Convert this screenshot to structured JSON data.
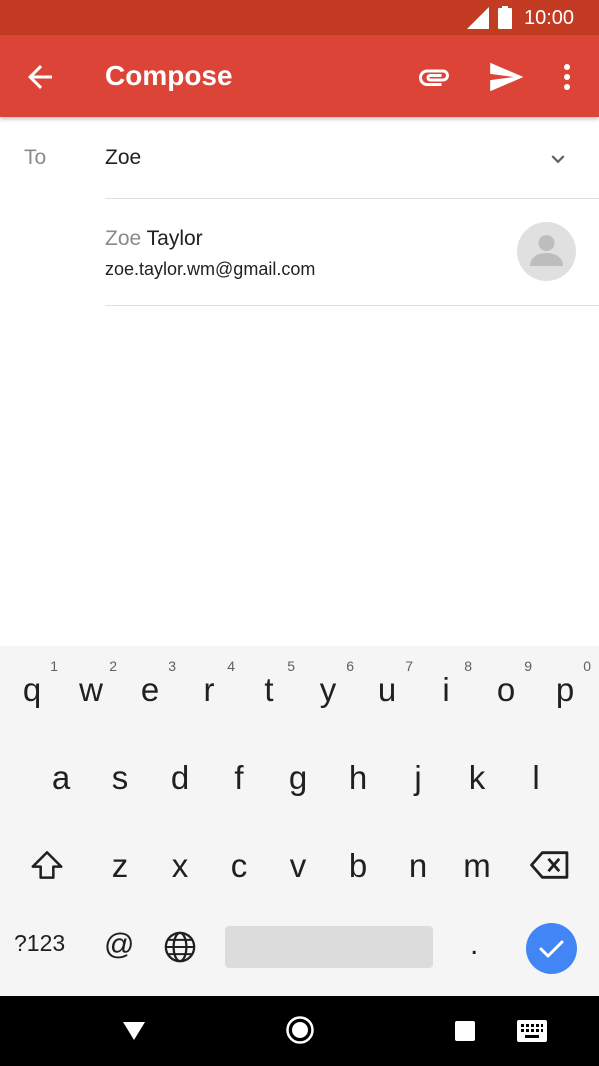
{
  "status_bar": {
    "time": "10:00"
  },
  "app_bar": {
    "title": "Compose"
  },
  "to_field": {
    "label": "To",
    "value": "Zoe"
  },
  "suggestion": {
    "name_match": "Zoe",
    "name_rest": " Taylor",
    "email": "zoe.taylor.wm@gmail.com"
  },
  "keyboard": {
    "row1": [
      {
        "char": "q",
        "hint": "1"
      },
      {
        "char": "w",
        "hint": "2"
      },
      {
        "char": "e",
        "hint": "3"
      },
      {
        "char": "r",
        "hint": "4"
      },
      {
        "char": "t",
        "hint": "5"
      },
      {
        "char": "y",
        "hint": "6"
      },
      {
        "char": "u",
        "hint": "7"
      },
      {
        "char": "i",
        "hint": "8"
      },
      {
        "char": "o",
        "hint": "9"
      },
      {
        "char": "p",
        "hint": "0"
      }
    ],
    "row2": [
      "a",
      "s",
      "d",
      "f",
      "g",
      "h",
      "j",
      "k",
      "l"
    ],
    "row3": [
      "z",
      "x",
      "c",
      "v",
      "b",
      "n",
      "m"
    ],
    "symbols_label": "?123",
    "at_label": "@",
    "period_label": "."
  },
  "colors": {
    "status_bar": "#c23b22",
    "app_bar": "#db4437",
    "done_button": "#4285f4"
  }
}
